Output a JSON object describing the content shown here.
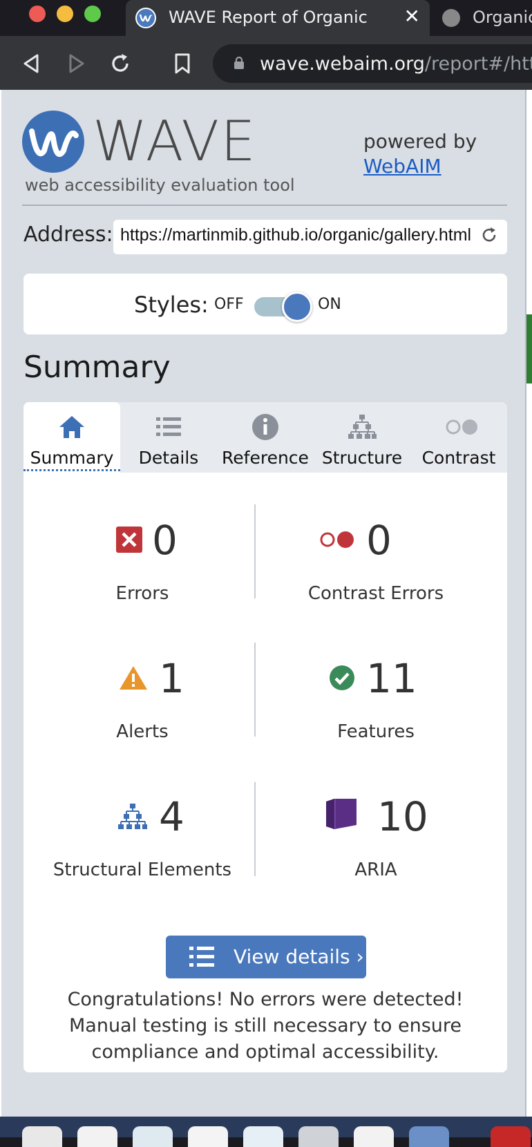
{
  "browser": {
    "active_tab_title": "WAVE Report of Organic",
    "other_tab_title": "Organic",
    "url_host": "wave.webaim.org",
    "url_path": "/report#/http"
  },
  "header": {
    "logo_text": "WAVE",
    "tagline": "web accessibility evaluation tool",
    "powered_by": "powered by",
    "webaim_link": "WebAIM"
  },
  "address": {
    "label": "Address:",
    "value": "https://martinmib.github.io/organic/gallery.html"
  },
  "styles_toggle": {
    "label": "Styles:",
    "off": "OFF",
    "on": "ON",
    "state": "on"
  },
  "summary_heading": "Summary",
  "tabs": [
    {
      "label": "Summary",
      "icon": "home-icon",
      "active": true
    },
    {
      "label": "Details",
      "icon": "list-icon",
      "active": false
    },
    {
      "label": "Reference",
      "icon": "info-icon",
      "active": false
    },
    {
      "label": "Structure",
      "icon": "hierarchy-icon",
      "active": false
    },
    {
      "label": "Contrast",
      "icon": "contrast-icon",
      "active": false
    }
  ],
  "stats": {
    "errors": {
      "count": "0",
      "label": "Errors",
      "icon": "error-icon"
    },
    "contrast_errors": {
      "count": "0",
      "label": "Contrast Errors",
      "icon": "contrast-error-icon"
    },
    "alerts": {
      "count": "1",
      "label": "Alerts",
      "icon": "alert-icon"
    },
    "features": {
      "count": "11",
      "label": "Features",
      "icon": "feature-check-icon"
    },
    "structural": {
      "count": "4",
      "label": "Structural Elements",
      "icon": "structure-icon"
    },
    "aria": {
      "count": "10",
      "label": "ARIA",
      "icon": "aria-icon"
    }
  },
  "view_details_button": "View details ›",
  "message": "Congratulations! No errors were detected! Manual testing is still necessary to ensure compliance and optimal accessibility.",
  "colors": {
    "accent": "#4a78bd",
    "error": "#c0353a",
    "alert": "#e8952c",
    "feature": "#3b8a5a",
    "aria": "#5b2e86"
  }
}
